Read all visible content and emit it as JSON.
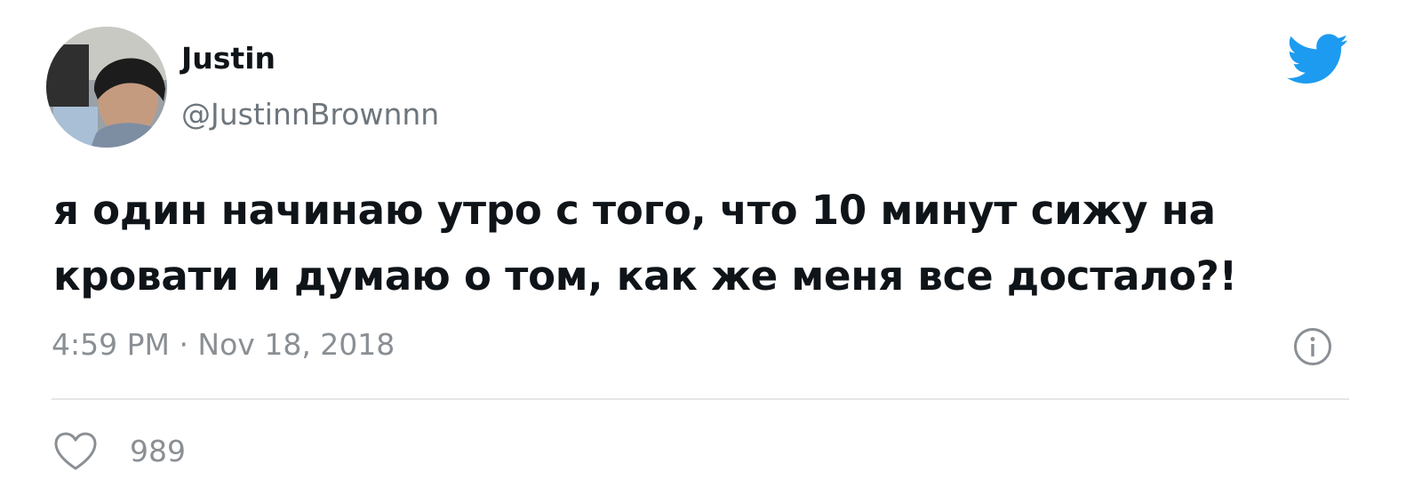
{
  "author": {
    "display_name": "Justin",
    "handle": "@JustinnBrownnn",
    "avatar_icon": "user-avatar-photo"
  },
  "tweet": {
    "text_line_1": "я один начинаю утро с того, что 10 минут сижу на",
    "text_line_2": "кровати и думаю о том, как же меня все достало?!",
    "timestamp": "4:59 PM · Nov 18, 2018"
  },
  "actions": {
    "like_count": "989",
    "like_icon": "heart-outline-icon",
    "info_icon": "info-icon"
  },
  "brand": {
    "logo_icon": "twitter-bird-icon",
    "color": "#1d9bf0"
  }
}
